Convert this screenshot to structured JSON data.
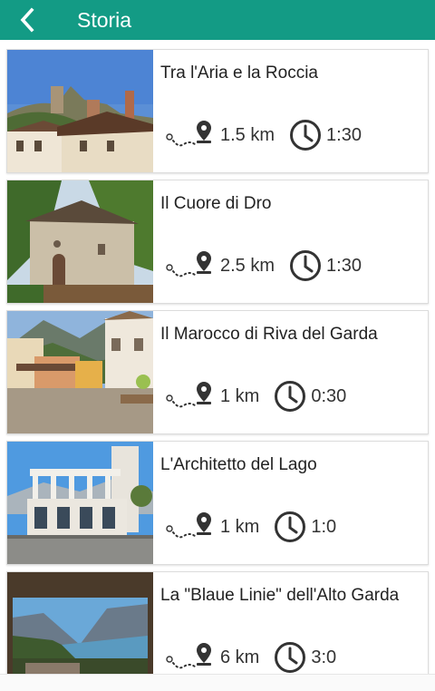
{
  "header": {
    "title": "Storia",
    "back_icon": "chevron-left-icon",
    "background_color": "#139b85"
  },
  "routes": [
    {
      "title": "Tra l'Aria e la Roccia",
      "distance": "1.5 km",
      "duration": "1:30"
    },
    {
      "title": "Il Cuore di Dro",
      "distance": "2.5 km",
      "duration": "1:30"
    },
    {
      "title": "Il Marocco di Riva del Garda",
      "distance": "1 km",
      "duration": "0:30"
    },
    {
      "title": "L'Architetto del Lago",
      "distance": "1 km",
      "duration": "1:0"
    },
    {
      "title": "La \"Blaue Linie\" dell'Alto Garda",
      "distance": "6 km",
      "duration": "3:0"
    }
  ],
  "icons": {
    "distance": "map-pin-path-icon",
    "duration": "clock-icon"
  }
}
